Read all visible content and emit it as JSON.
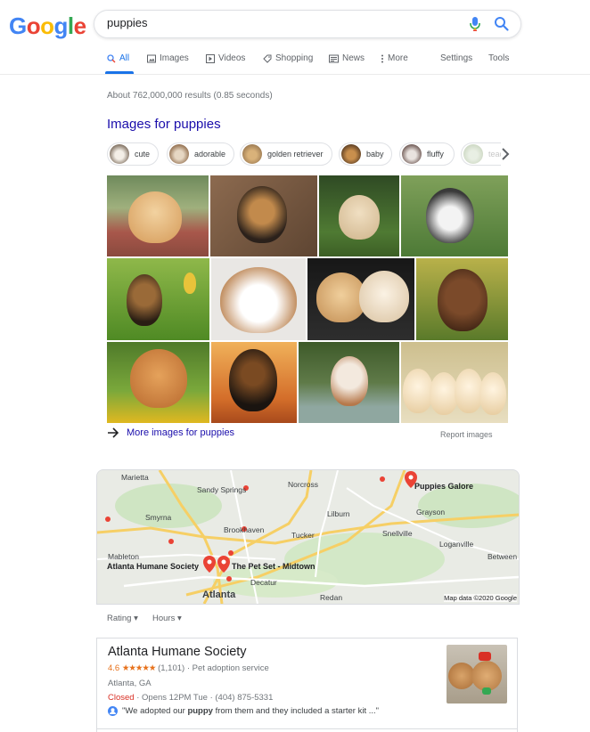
{
  "logo": {
    "letters": [
      "G",
      "o",
      "o",
      "g",
      "l",
      "e"
    ]
  },
  "search": {
    "value": "puppies",
    "mic_icon": "mic-icon",
    "search_icon": "search-icon"
  },
  "tabs": [
    {
      "label": "All",
      "icon": "search-icon",
      "active": true
    },
    {
      "label": "Images",
      "icon": "image-icon"
    },
    {
      "label": "Videos",
      "icon": "play-icon"
    },
    {
      "label": "Shopping",
      "icon": "tag-icon"
    },
    {
      "label": "News",
      "icon": "news-icon"
    },
    {
      "label": "More",
      "icon": "more-vert-icon"
    },
    {
      "label": "Settings"
    },
    {
      "label": "Tools"
    }
  ],
  "stats": "About 762,000,000 results (0.85 seconds)",
  "images_section": {
    "heading": "Images for puppies",
    "chips": [
      "cute",
      "adorable",
      "golden retriever",
      "baby",
      "fluffy",
      "teacup"
    ],
    "more_link": "More images for puppies",
    "report": "Report images"
  },
  "map": {
    "labels": [
      "Marietta",
      "Sandy Springs",
      "Norcross",
      "Smyrna",
      "Lilburn",
      "Grayson",
      "Brookhaven",
      "Tucker",
      "Snellville",
      "Loganville",
      "Mableton",
      "Between",
      "Decatur",
      "Redan",
      "Atlanta"
    ],
    "places": [
      "Puppies Galore",
      "Atlanta Humane Society",
      "The Pet Set - Midtown"
    ],
    "attribution": "Map data ©2020 Google"
  },
  "filters": [
    "Rating",
    "Hours"
  ],
  "result": {
    "title": "Atlanta Humane Society",
    "rating": "4.6",
    "stars": "★★★★★",
    "reviews": "(1,101)",
    "category": "· Pet adoption service",
    "address": "Atlanta, GA",
    "status": "Closed",
    "hours_rest": "· Opens 12PM Tue · (404) 875-5331",
    "review_prefix": "\"We adopted our ",
    "review_bold": "puppy",
    "review_suffix": " from them and they included a starter kit ...\""
  },
  "colors": {
    "link": "#1a0dab",
    "accent": "#1a73e8",
    "closed": "#d93025",
    "star": "#e7711b",
    "pin": "#ea4335"
  }
}
